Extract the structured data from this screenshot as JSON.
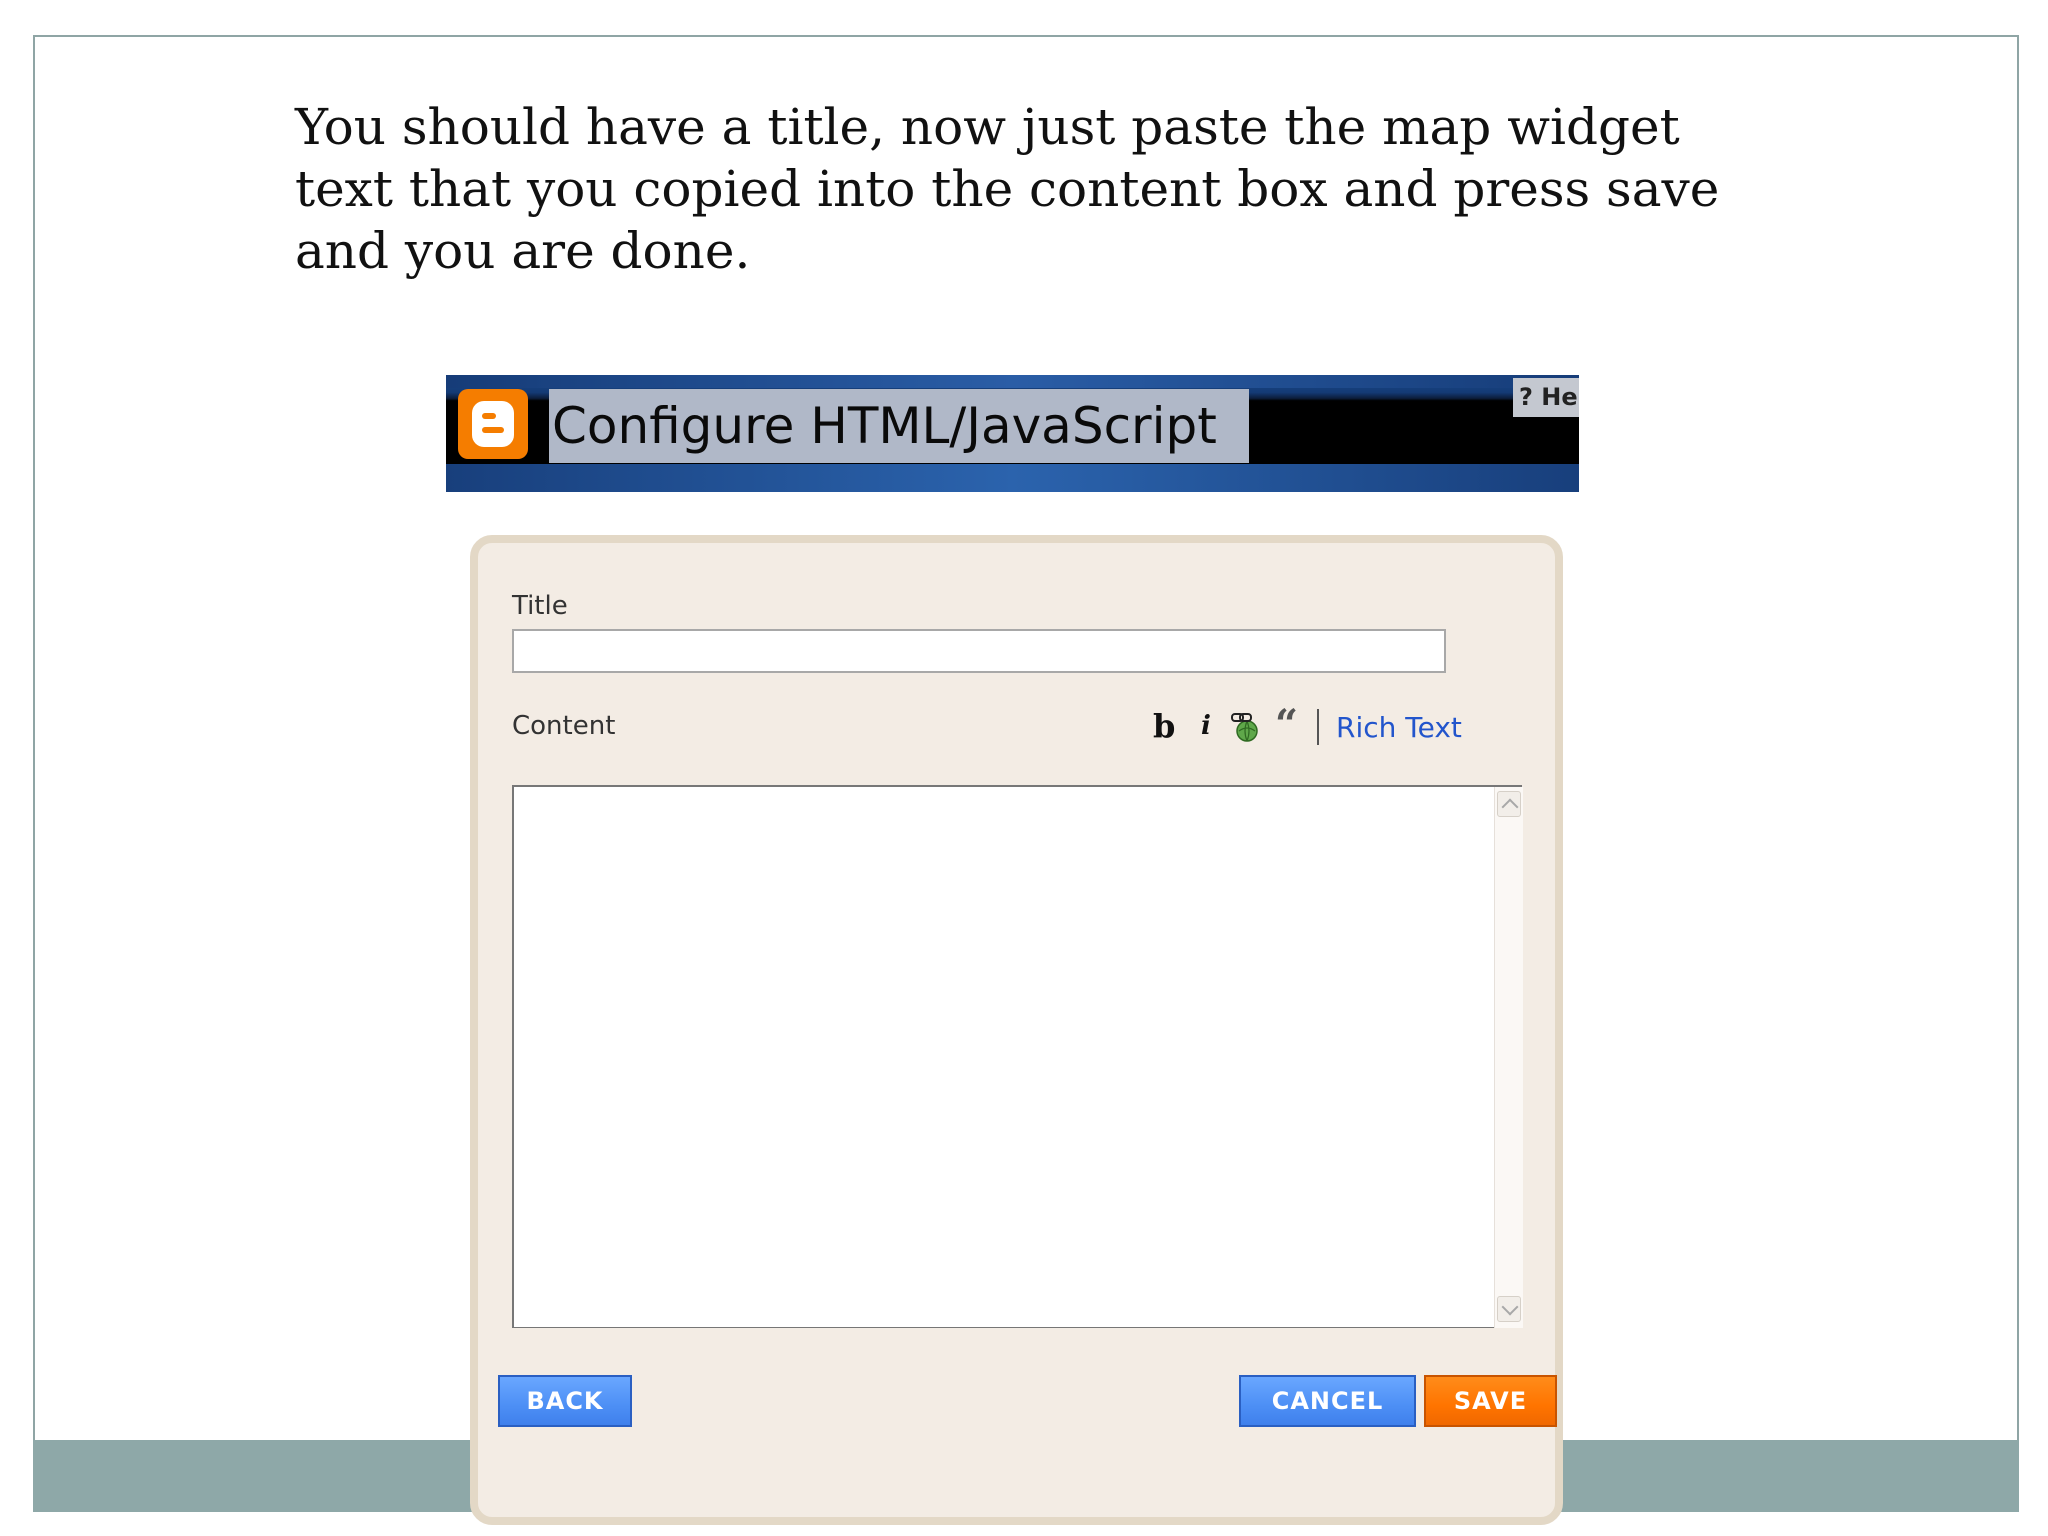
{
  "slide": {
    "text": "You should have a title, now just paste the map widget text that you copied into the content box and press save and you are done."
  },
  "header": {
    "title": "Configure HTML/JavaScript",
    "help_label": "? Hel"
  },
  "form": {
    "title_label": "Title",
    "title_value": "",
    "content_label": "Content",
    "content_value": "",
    "toolbar": {
      "bold_label": "b",
      "italic_label": "i",
      "link_icon": "link-globe-icon",
      "quote_label": "“",
      "rich_text_label": "Rich Text"
    }
  },
  "buttons": {
    "back": "BACK",
    "cancel": "CANCEL",
    "save": "SAVE"
  },
  "colors": {
    "accent_orange": "#f57d00",
    "button_blue": "#4d8ff5",
    "panel_bg": "#f3ece4",
    "footer_bar": "#8ea8a8",
    "link_blue": "#2255cc"
  }
}
